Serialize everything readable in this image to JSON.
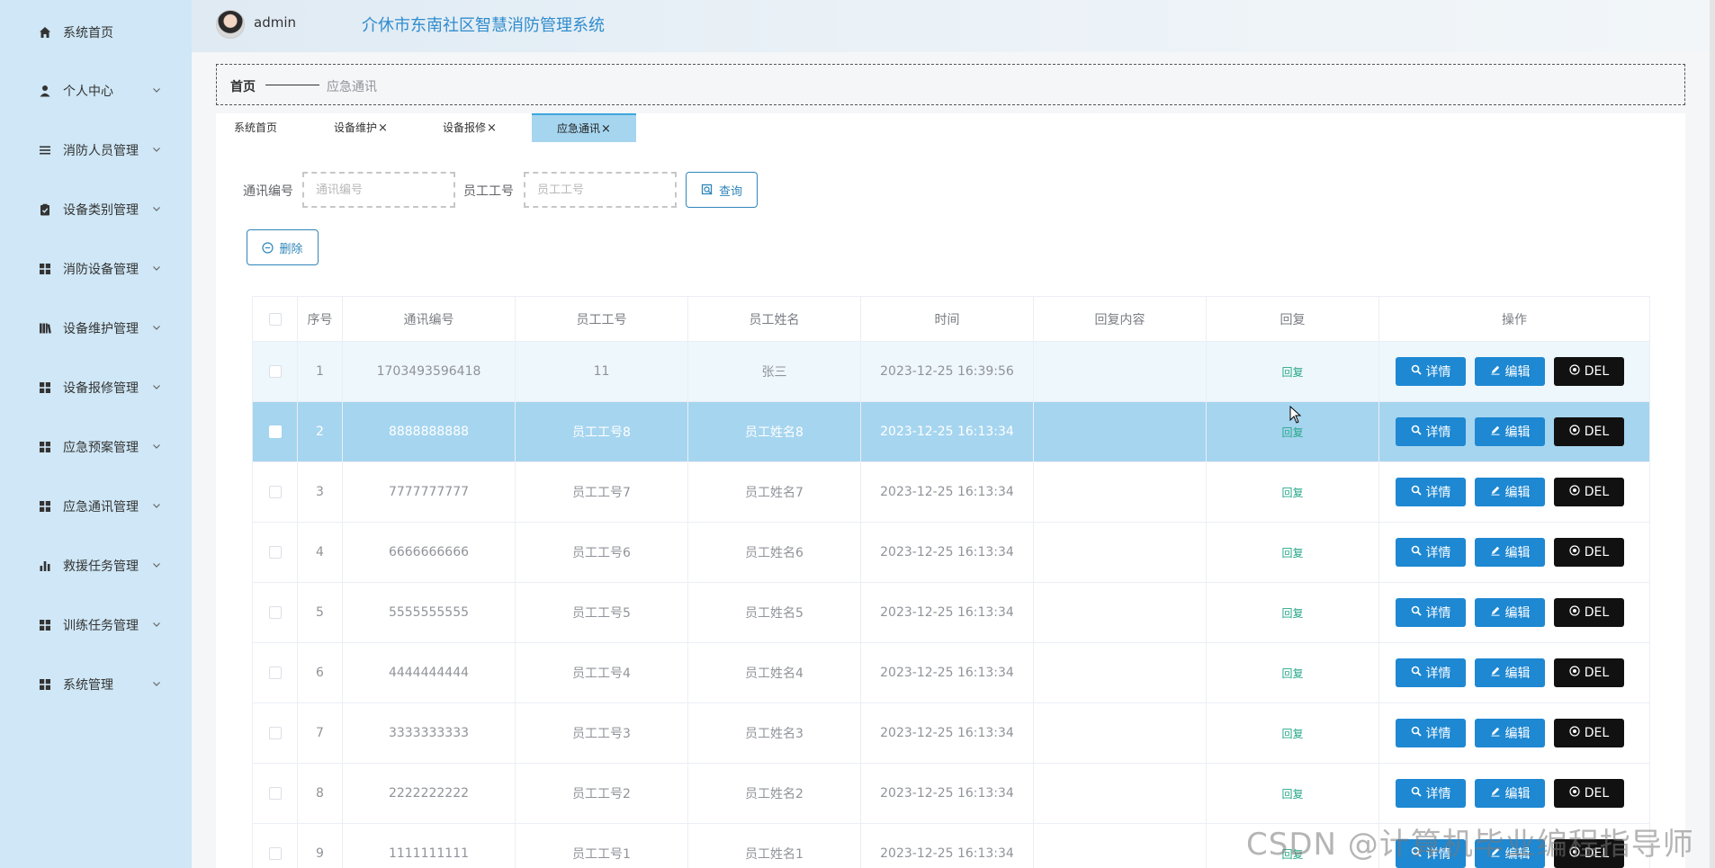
{
  "header": {
    "username": "admin",
    "title": "介休市东南社区智慧消防管理系统"
  },
  "sidebar": {
    "items": [
      {
        "label": "系统首页",
        "icon": "home-icon",
        "has_arrow": false
      },
      {
        "label": "个人中心",
        "icon": "user-icon",
        "has_arrow": true
      },
      {
        "label": "消防人员管理",
        "icon": "list-icon",
        "has_arrow": true
      },
      {
        "label": "设备类别管理",
        "icon": "clipboard-icon",
        "has_arrow": true
      },
      {
        "label": "消防设备管理",
        "icon": "grid-icon",
        "has_arrow": true
      },
      {
        "label": "设备维护管理",
        "icon": "books-icon",
        "has_arrow": true
      },
      {
        "label": "设备报修管理",
        "icon": "grid-icon",
        "has_arrow": true
      },
      {
        "label": "应急预案管理",
        "icon": "grid-icon",
        "has_arrow": true
      },
      {
        "label": "应急通讯管理",
        "icon": "grid-icon",
        "has_arrow": true
      },
      {
        "label": "救援任务管理",
        "icon": "bar-chart-icon",
        "has_arrow": true
      },
      {
        "label": "训练任务管理",
        "icon": "grid-icon",
        "has_arrow": true
      },
      {
        "label": "系统管理",
        "icon": "grid-icon",
        "has_arrow": true
      }
    ]
  },
  "breadcrumb": {
    "home": "首页",
    "current": "应急通讯"
  },
  "tabs": [
    {
      "label": "系统首页",
      "closable": false,
      "active": false
    },
    {
      "label": "设备维护",
      "closable": true,
      "active": false
    },
    {
      "label": "设备报修",
      "closable": true,
      "active": false
    },
    {
      "label": "应急通讯",
      "closable": true,
      "active": true
    }
  ],
  "tab_close_glyph": "×",
  "search": {
    "field1_label": "通讯编号",
    "field1_placeholder": "通讯编号",
    "field2_label": "员工工号",
    "field2_placeholder": "员工工号",
    "query_label": "查询",
    "delete_label": "删除"
  },
  "table": {
    "columns": [
      "序号",
      "通讯编号",
      "员工工号",
      "员工姓名",
      "时间",
      "回复内容",
      "回复",
      "操作"
    ],
    "reply_label": "回复",
    "detail_label": "详情",
    "edit_label": "编辑",
    "del_label": "DEL",
    "rows": [
      {
        "index": "1",
        "comm_no": "1703493596418",
        "emp_no": "11",
        "emp_name": "张三",
        "time": "2023-12-25 16:39:56",
        "reply_content": ""
      },
      {
        "index": "2",
        "comm_no": "8888888888",
        "emp_no": "员工工号8",
        "emp_name": "员工姓名8",
        "time": "2023-12-25 16:13:34",
        "reply_content": ""
      },
      {
        "index": "3",
        "comm_no": "7777777777",
        "emp_no": "员工工号7",
        "emp_name": "员工姓名7",
        "time": "2023-12-25 16:13:34",
        "reply_content": ""
      },
      {
        "index": "4",
        "comm_no": "6666666666",
        "emp_no": "员工工号6",
        "emp_name": "员工姓名6",
        "time": "2023-12-25 16:13:34",
        "reply_content": ""
      },
      {
        "index": "5",
        "comm_no": "5555555555",
        "emp_no": "员工工号5",
        "emp_name": "员工姓名5",
        "time": "2023-12-25 16:13:34",
        "reply_content": ""
      },
      {
        "index": "6",
        "comm_no": "4444444444",
        "emp_no": "员工工号4",
        "emp_name": "员工姓名4",
        "time": "2023-12-25 16:13:34",
        "reply_content": ""
      },
      {
        "index": "7",
        "comm_no": "3333333333",
        "emp_no": "员工工号3",
        "emp_name": "员工姓名3",
        "time": "2023-12-25 16:13:34",
        "reply_content": ""
      },
      {
        "index": "8",
        "comm_no": "2222222222",
        "emp_no": "员工工号2",
        "emp_name": "员工姓名2",
        "time": "2023-12-25 16:13:34",
        "reply_content": ""
      },
      {
        "index": "9",
        "comm_no": "1111111111",
        "emp_no": "员工工号1",
        "emp_name": "员工姓名1",
        "time": "2023-12-25 16:13:34",
        "reply_content": ""
      }
    ]
  },
  "watermark": "CSDN @计算机毕业编程指导师",
  "colors": {
    "sidebar_bg": "#cfe7f6",
    "title_blue": "#2f8ccd",
    "selected_row": "#a6d5ef",
    "primary_button": "#1e88d2",
    "del_button": "#111111",
    "reply_green": "#27a789"
  }
}
